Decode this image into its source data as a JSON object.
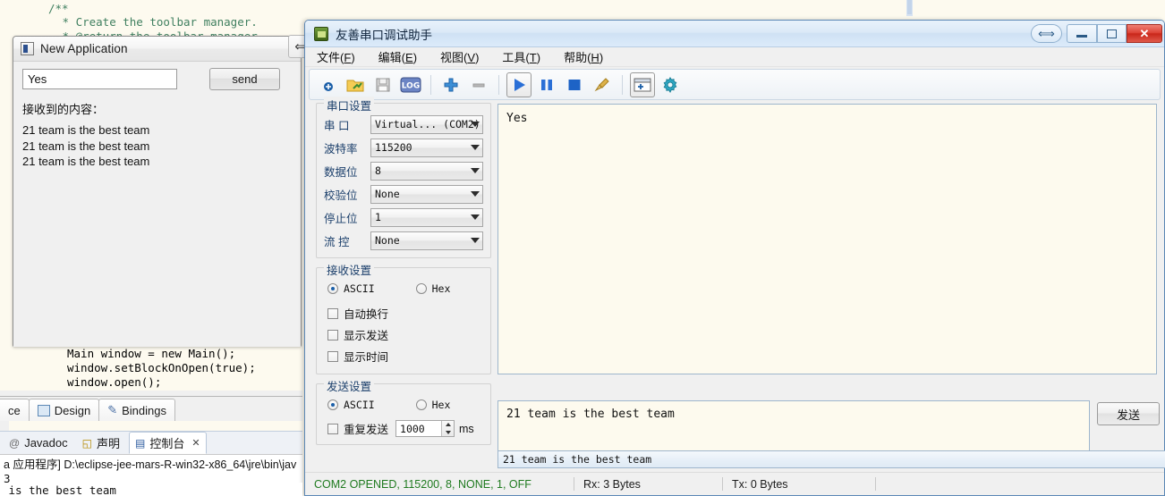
{
  "eclipse": {
    "code_top": [
      "/**",
      " * Create the toolbar manager.",
      " * @return the toolbar manager"
    ],
    "code_mid": [
      "Main window = new Main();",
      "window.setBlockOnOpen(true);",
      "window.open();"
    ],
    "design_tabs": [
      {
        "label": "ce",
        "icon": "source-icon"
      },
      {
        "label": "Design",
        "icon": "design-icon"
      },
      {
        "label": "Bindings",
        "icon": "bindings-icon"
      }
    ],
    "console_tabs": [
      {
        "label": "Javadoc",
        "icon": "javadoc-icon",
        "active": false
      },
      {
        "label": "声明",
        "icon": "declaration-icon",
        "active": false
      },
      {
        "label": "控制台",
        "icon": "console-icon",
        "active": true
      }
    ],
    "console_close_glyph": "✕",
    "console_lines": [
      "a 应用程序] D:\\eclipse-jee-mars-R-win32-x86_64\\jre\\bin\\jav",
      "3",
      " is the best team"
    ]
  },
  "new_app": {
    "title": "New Application",
    "input_value": "Yes",
    "input_placeholder": "",
    "send_label": "send",
    "received_label": "接收到的内容：",
    "received_lines": [
      "21 team is the best team",
      "21 team is the best team",
      "21 team is the best team"
    ],
    "resize_glyph": "⟺"
  },
  "serial": {
    "title": "友善串口调试助手",
    "window_buttons": {
      "help": "?",
      "minimize": "minimize",
      "maximize": "maximize",
      "close": "✕"
    },
    "menus": [
      {
        "label": "文件",
        "accel": "F"
      },
      {
        "label": "编辑",
        "accel": "E"
      },
      {
        "label": "视图",
        "accel": "V"
      },
      {
        "label": "工具",
        "accel": "T"
      },
      {
        "label": "帮助",
        "accel": "H"
      }
    ],
    "toolbar": [
      {
        "name": "new-icon",
        "glyph": ""
      },
      {
        "name": "open-folder-icon",
        "glyph": ""
      },
      {
        "name": "save-icon",
        "glyph": ""
      },
      {
        "name": "log-icon",
        "glyph": "LOG"
      },
      {
        "name": "add-icon",
        "glyph": ""
      },
      {
        "name": "remove-icon",
        "glyph": ""
      },
      {
        "name": "play-icon",
        "glyph": ""
      },
      {
        "name": "pause-icon",
        "glyph": ""
      },
      {
        "name": "stop-icon",
        "glyph": ""
      },
      {
        "name": "clear-broom-icon",
        "glyph": ""
      },
      {
        "name": "new-tab-icon",
        "glyph": "+"
      },
      {
        "name": "settings-gear-icon",
        "glyph": ""
      }
    ],
    "port_group": {
      "title": "串口设置",
      "fields": [
        {
          "label": "串  口",
          "value": "Virtual... (COM2)"
        },
        {
          "label": "波特率",
          "value": "115200"
        },
        {
          "label": "数据位",
          "value": "8"
        },
        {
          "label": "校验位",
          "value": "None"
        },
        {
          "label": "停止位",
          "value": "1"
        },
        {
          "label": "流  控",
          "value": "None"
        }
      ]
    },
    "recv_group": {
      "title": "接收设置",
      "ascii_label": "ASCII",
      "hex_label": "Hex",
      "mode": "ASCII",
      "checks": [
        {
          "label": "自动换行",
          "checked": false
        },
        {
          "label": "显示发送",
          "checked": false
        },
        {
          "label": "显示时间",
          "checked": false
        }
      ]
    },
    "send_group": {
      "title": "发送设置",
      "ascii_label": "ASCII",
      "hex_label": "Hex",
      "mode": "ASCII",
      "repeat_label": "重复发送",
      "repeat_checked": false,
      "interval_value": "1000",
      "interval_unit": "ms"
    },
    "receive_text": "Yes",
    "send_text": "21 team is the best team",
    "history_value": "21 team is the best team",
    "send_button_label": "发送",
    "status": {
      "connection": "COM2 OPENED, 115200, 8, NONE, 1, OFF",
      "rx": "Rx: 3 Bytes",
      "tx": "Tx: 0 Bytes"
    }
  },
  "colors": {
    "status_green": "#1f7a1f",
    "accent_blue": "#1b5fa8",
    "close_red": "#c9261a",
    "editor_cream": "#fdfaee"
  }
}
